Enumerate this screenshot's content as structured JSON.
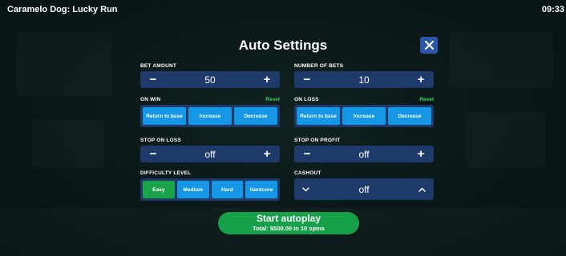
{
  "topbar": {
    "game_title": "Caramelo Dog: Lucky Run",
    "time": "09:33"
  },
  "modal": {
    "title": "Auto Settings",
    "close_icon": "close-icon"
  },
  "bet_amount": {
    "label": "BET AMOUNT",
    "value": "50",
    "minus": "−",
    "plus": "+"
  },
  "number_of_bets": {
    "label": "NUMBER OF BETS",
    "value": "10",
    "minus": "−",
    "plus": "+"
  },
  "on_win": {
    "label": "ON WIN",
    "reset": "Reset",
    "options": [
      "Return to base",
      "Increase",
      "Decrease"
    ]
  },
  "on_loss": {
    "label": "ON LOSS",
    "reset": "Reset",
    "options": [
      "Return to base",
      "Increase",
      "Decrease"
    ]
  },
  "stop_on_loss": {
    "label": "STOP ON LOSS",
    "value": "off",
    "minus": "−",
    "plus": "+"
  },
  "stop_on_profit": {
    "label": "STOP ON PROFIT",
    "value": "off",
    "minus": "−",
    "plus": "+"
  },
  "difficulty": {
    "label": "DIFFICULTY LEVEL",
    "options": [
      "Easy",
      "Medium",
      "Hard",
      "Hardcore"
    ],
    "selected": "Easy"
  },
  "cashout": {
    "label": "CASHOUT",
    "value": "off"
  },
  "start": {
    "label": "Start autoplay",
    "summary": "Total: $500.00 in 10 spins"
  },
  "colors": {
    "panel": "#1d3a6a",
    "option_blue": "#1597e5",
    "selected_green": "#1aa34a",
    "reset_green": "#3fd36a",
    "start_green": "#16a04a",
    "close_button": "#2b57a8"
  }
}
